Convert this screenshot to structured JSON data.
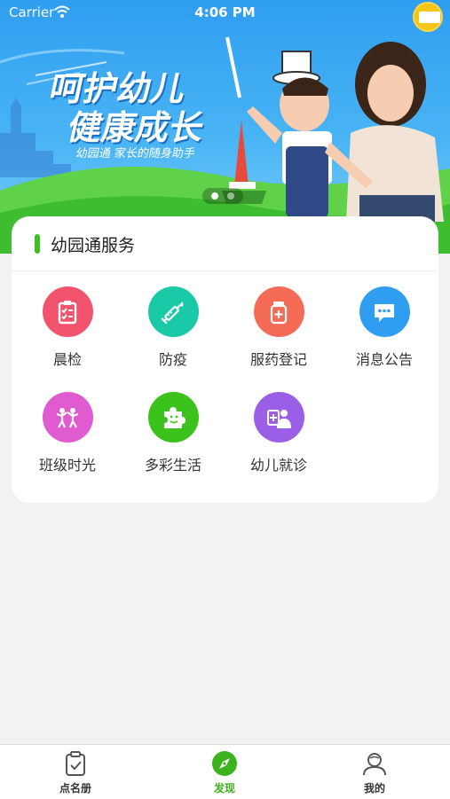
{
  "status_bar": {
    "carrier": "Carrier",
    "time": "4:06 PM"
  },
  "banner": {
    "title_line1": "呵护幼儿",
    "title_line2": "健康成长",
    "subtitle": "幼园通 家长的随身助手",
    "active_slide": 1,
    "slide_count": 2
  },
  "service_card": {
    "title": "幼园通服务",
    "accent_color": "#3cc21c",
    "items": [
      {
        "label": "晨检",
        "icon": "clipboard-check-icon",
        "color": "#f2546e"
      },
      {
        "label": "防疫",
        "icon": "syringe-icon",
        "color": "#19c9a8"
      },
      {
        "label": "服药登记",
        "icon": "medicine-bottle-icon",
        "color": "#f46c55"
      },
      {
        "label": "消息公告",
        "icon": "chat-bubble-icon",
        "color": "#2f9ef0"
      },
      {
        "label": "班级时光",
        "icon": "children-play-icon",
        "color": "#e05ad0"
      },
      {
        "label": "多彩生活",
        "icon": "puzzle-piece-icon",
        "color": "#3cc21c"
      },
      {
        "label": "幼儿就诊",
        "icon": "doctor-icon",
        "color": "#9a5fe6"
      }
    ]
  },
  "tab_bar": {
    "active_color": "#3cb21c",
    "tabs": [
      {
        "label": "点名册",
        "icon": "clipboard-icon",
        "active": false
      },
      {
        "label": "发现",
        "icon": "compass-icon",
        "active": true
      },
      {
        "label": "我的",
        "icon": "user-icon",
        "active": false
      }
    ]
  }
}
